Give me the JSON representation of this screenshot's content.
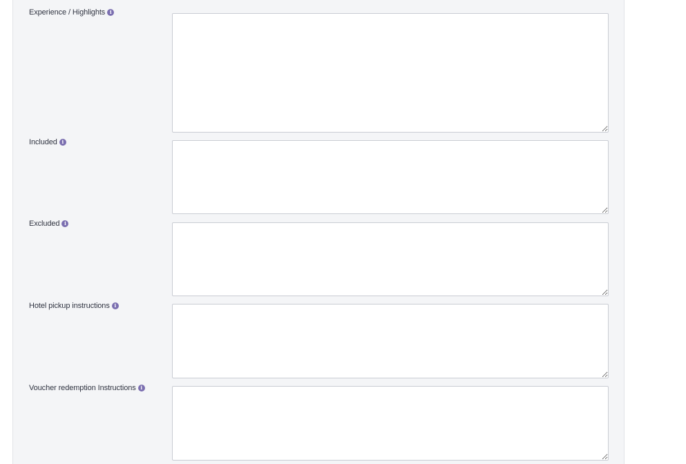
{
  "form": {
    "fields": [
      {
        "label": "Experience / Highlights",
        "value": "",
        "info_icon": "info-icon"
      },
      {
        "label": "Included",
        "value": "",
        "info_icon": "info-icon"
      },
      {
        "label": "Excluded",
        "value": "",
        "info_icon": "info-icon"
      },
      {
        "label": "Hotel pickup instructions",
        "value": "",
        "info_icon": "info-icon"
      },
      {
        "label": "Voucher redemption Instructions",
        "value": "",
        "info_icon": "info-icon"
      }
    ]
  },
  "colors": {
    "panel_background": "#f4f5f7",
    "info_icon": "#7b6fb0",
    "textarea_border": "#c9ccd3"
  }
}
